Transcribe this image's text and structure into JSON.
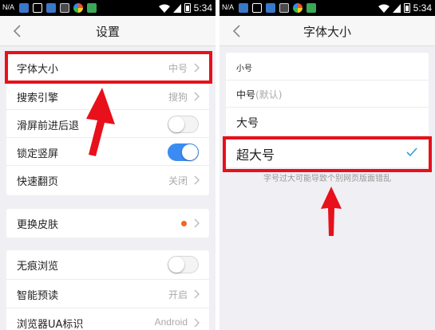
{
  "status": {
    "carrier": "N/A",
    "time": "5:34"
  },
  "left": {
    "title": "设置",
    "rows": [
      {
        "label": "字体大小",
        "value": "中号"
      },
      {
        "label": "搜索引擎",
        "value": "搜狗"
      },
      {
        "label": "滑屏前进后退",
        "toggle": false
      },
      {
        "label": "锁定竖屏",
        "toggle": true
      },
      {
        "label": "快速翻页",
        "value": "关闭"
      },
      {
        "label": "更换皮肤",
        "badge": true
      },
      {
        "label": "无痕浏览",
        "toggle": false
      },
      {
        "label": "智能预读",
        "value": "开启"
      },
      {
        "label": "浏览器UA标识",
        "value": "Android"
      }
    ]
  },
  "right": {
    "title": "字体大小",
    "options": [
      {
        "label": "小号",
        "note": ""
      },
      {
        "label": "中号",
        "note": "(默认)"
      },
      {
        "label": "大号",
        "note": ""
      },
      {
        "label": "超大号",
        "note": ""
      }
    ],
    "selected": "超大号",
    "note": "字号过大可能导致个别网页版面错乱"
  },
  "colors": {
    "highlight": "#e8101a",
    "toggle_on": "#3b8cf2",
    "badge": "#f26522",
    "check": "#3a9bd8"
  },
  "icons": [
    "back-arrow-icon",
    "chevron-right-icon",
    "checkmark-icon",
    "wifi-icon",
    "signal-icon",
    "battery-icon"
  ]
}
